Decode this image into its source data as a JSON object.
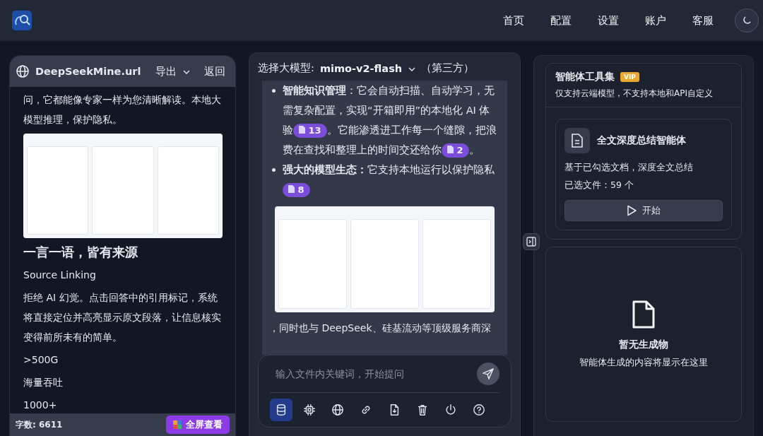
{
  "nav": [
    {
      "label": "首页"
    },
    {
      "label": "配置"
    },
    {
      "label": "设置"
    },
    {
      "label": "账户"
    },
    {
      "label": "客服"
    }
  ],
  "document": {
    "title": "DeepSeekMine.url",
    "export": "导出",
    "back": "返回",
    "intro": "问，它都能像专家一样为您清晰解读。本地大模型推理，保护隐私。",
    "heading": "一言一语，皆有来源",
    "paragraphs": [
      "Source Linking",
      "拒绝 AI 幻觉。点击回答中的引用标记，系统将直接定位并高亮显示原文段落，让信息核实变得前所未有的简单。",
      ">500G",
      "海量吞吐",
      "1000+"
    ],
    "word_count": "字数: 6611",
    "fullscreen": "全屏查看"
  },
  "chat": {
    "model_label": "选择大模型:",
    "model": "mimo-v2-flash",
    "model_note": "（第三方）",
    "bullets": [
      [
        {
          "kind": "bold",
          "text": "智能知识管理"
        },
        {
          "kind": "text",
          "text": "：它会自动扫描、自动学习，无需复杂配置，实现“开箱即用”的本地化 AI 体验"
        },
        {
          "kind": "cite",
          "text": "13"
        },
        {
          "kind": "text",
          "text": "。它能渗透进工作每一个缝隙，把浪费在查找和整理上的时间交还给你"
        },
        {
          "kind": "cite",
          "text": "2"
        },
        {
          "kind": "text",
          "text": "。"
        }
      ],
      [
        {
          "kind": "bold",
          "text": "强大的模型生态："
        },
        {
          "kind": "text",
          "text": "它支持本地运行以保护隐私"
        },
        {
          "kind": "cite",
          "text": "8"
        }
      ]
    ],
    "after": "，同时也与 DeepSeek、硅基流动等顶级服务商深",
    "placeholder": "输入文件内关键词，开始提问",
    "tools": [
      {
        "kind": "database",
        "selected": true
      },
      {
        "kind": "chip",
        "selected": false
      },
      {
        "kind": "globe",
        "selected": false
      },
      {
        "kind": "link",
        "selected": false
      },
      {
        "kind": "file",
        "selected": false
      },
      {
        "kind": "trash",
        "selected": false
      },
      {
        "kind": "power",
        "selected": false
      },
      {
        "kind": "help",
        "selected": false
      }
    ]
  },
  "agents": {
    "title": "智能体工具集",
    "badge": "VIP",
    "subtitle": "仅支持云端模型，不支持本地和API自定义",
    "card": {
      "title": "全文深度总结智能体",
      "description": "基于已勾选文档，深度全文总结",
      "files": "已选文件：59 个",
      "start": "开始"
    },
    "empty_title": "暂无生成物",
    "empty_text": "智能体生成的内容将显示在这里"
  }
}
